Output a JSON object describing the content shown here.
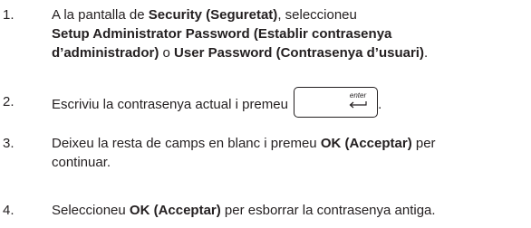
{
  "steps": [
    {
      "num": "1.",
      "t1": "A la pantalla de ",
      "b1": "Security (Seguretat)",
      "t2": ", seleccioneu",
      "b2": "Setup Administrator Password (Establir contrasenya",
      "b3": "d’administrador)",
      "t3": " o ",
      "b4": "User Password (Contrasenya d’usuari)",
      "t4": "."
    },
    {
      "num": "2.",
      "t1": "Escriviu la contrasenya actual i premeu ",
      "key_label": "enter",
      "t2": "."
    },
    {
      "num": "3.",
      "t1": "Deixeu la resta de camps en blanc i premeu ",
      "b1": "OK (Acceptar)",
      "t2": " per",
      "t3": "continuar."
    },
    {
      "num": "4.",
      "t1": "Seleccioneu ",
      "b1": "OK (Acceptar)",
      "t2": " per esborrar la contrasenya antiga."
    }
  ]
}
